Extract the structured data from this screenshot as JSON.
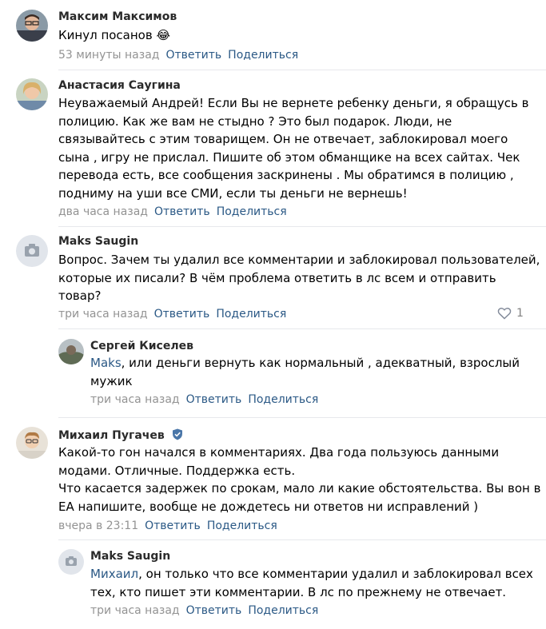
{
  "comments": [
    {
      "author": "Максим Максимов",
      "text_lines": [
        "Кинул посанов 😂"
      ],
      "time": "53 минуты назад",
      "reply": "Ответить",
      "share": "Поделиться"
    },
    {
      "author": "Анастасия Саугина",
      "text_lines": [
        "Неуважаемый Андрей! Если Вы не вернете ребенку деньги, я обращусь в",
        "полицию. Как же вам не стыдно ? Это был подарок. Люди, не",
        "связывайтесь с этим товарищем. Он не отвечает, заблокировал моего",
        "сына , игру не прислал. Пишите об этом обманщике на всех сайтах. Чек",
        "перевода есть, все сообщения заскринены . Мы обратимся в полицию ,",
        "подниму на уши все СМИ, если ты деньги не вернешь!"
      ],
      "time": "два часа назад",
      "reply": "Ответить",
      "share": "Поделиться"
    },
    {
      "author": "Maks Saugin",
      "text_lines": [
        "Вопрос. Зачем ты удалил все комментарии и заблокировал пользователей,",
        "которые их писали? В чём проблема ответить в лс всем и отправить",
        "товар?"
      ],
      "time": "три часа назад",
      "reply": "Ответить",
      "share": "Поделиться",
      "likes": "1"
    },
    {
      "author": "Сергей Киселев",
      "mention": "Maks",
      "text_lines": [
        ", или деньги вернуть как нормальный , адекватный, взрослый",
        "мужик"
      ],
      "time": "три часа назад",
      "reply": "Ответить",
      "share": "Поделиться"
    },
    {
      "author": "Михаил Пугачев",
      "text_lines": [
        "Какой-то гон начался в комментариях. Два года пользуюсь данными",
        "модами. Отличные. Поддержка есть.",
        "Что касается задержек по срокам, мало ли какие обстоятельства. Вы вон в",
        "ЕА напишите, вообще не дождетесь ни ответов ни исправлений )"
      ],
      "time": "вчера в 23:11",
      "reply": "Ответить",
      "share": "Поделиться"
    },
    {
      "author": "Maks Saugin",
      "mention": "Михаил",
      "text_lines": [
        ", он только что все комментарии удалил и заблокировал всех",
        "тех, кто пишет эти комментарии. В лс по прежнему не отвечает."
      ],
      "time": "три часа назад",
      "reply": "Ответить",
      "share": "Поделиться"
    }
  ],
  "colors": {
    "link": "#2a5885",
    "meta": "#939393",
    "divider": "#e7e8ec"
  },
  "icons": {
    "heart": "heart-icon",
    "verified": "verified-shield-icon",
    "camera": "camera-placeholder-icon"
  }
}
